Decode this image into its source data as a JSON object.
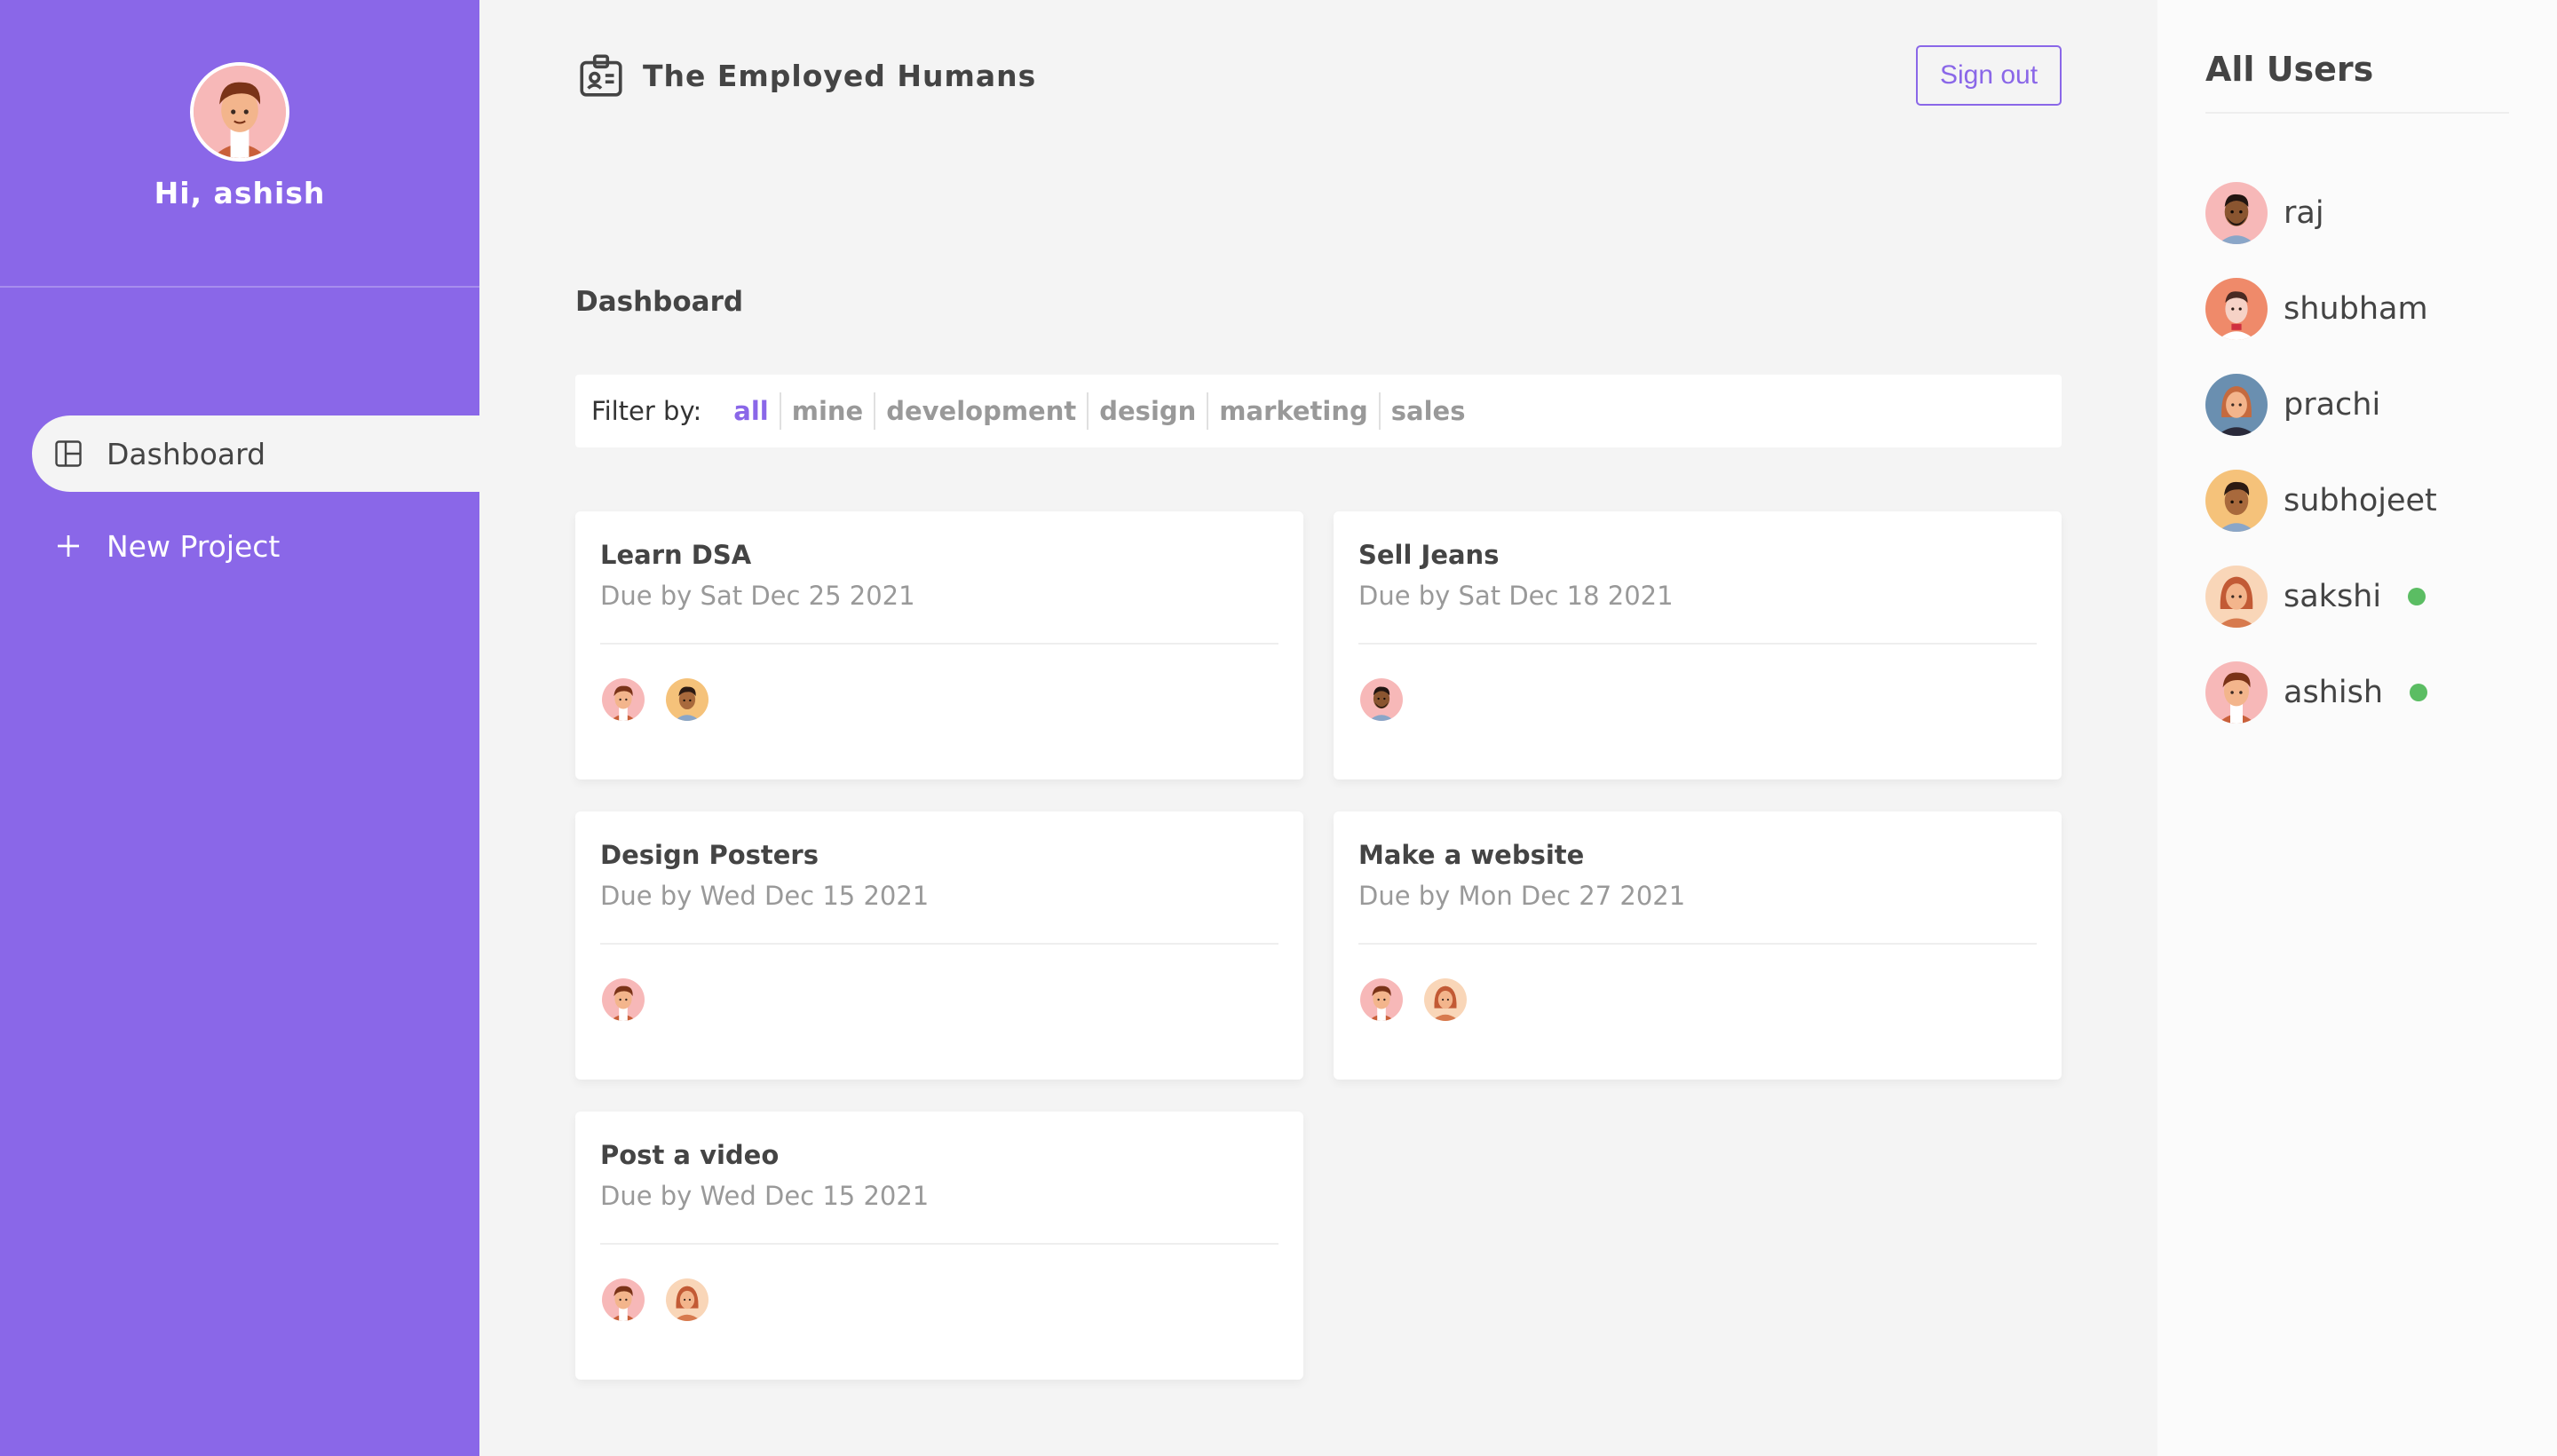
{
  "sidebar": {
    "greeting": "Hi, ashish",
    "nav": [
      {
        "label": "Dashboard",
        "icon": "dashboard-icon",
        "active": true
      },
      {
        "label": "New Project",
        "icon": "plus-icon",
        "active": false
      }
    ]
  },
  "header": {
    "app_name": "The Employed Humans",
    "sign_out_label": "Sign out"
  },
  "main": {
    "title": "Dashboard",
    "filter": {
      "label": "Filter by:",
      "options": [
        "all",
        "mine",
        "development",
        "design",
        "marketing",
        "sales"
      ],
      "active": "all"
    },
    "projects": [
      {
        "name": "Learn DSA",
        "due": "Due by Sat Dec 25 2021",
        "assignees": [
          "ashish",
          "subhojeet"
        ]
      },
      {
        "name": "Sell Jeans",
        "due": "Due by Sat Dec 18 2021",
        "assignees": [
          "raj"
        ]
      },
      {
        "name": "Design Posters",
        "due": "Due by Wed Dec 15 2021",
        "assignees": [
          "ashish"
        ]
      },
      {
        "name": "Make a website",
        "due": "Due by Mon Dec 27 2021",
        "assignees": [
          "ashish",
          "sakshi"
        ]
      },
      {
        "name": "Post a video",
        "due": "Due by Wed Dec 15 2021",
        "assignees": [
          "ashish",
          "sakshi"
        ]
      }
    ]
  },
  "users_panel": {
    "title": "All Users",
    "users": [
      {
        "name": "raj",
        "online": false
      },
      {
        "name": "shubham",
        "online": false
      },
      {
        "name": "prachi",
        "online": false
      },
      {
        "name": "subhojeet",
        "online": false
      },
      {
        "name": "sakshi",
        "online": true
      },
      {
        "name": "ashish",
        "online": true
      }
    ]
  },
  "colors": {
    "accent": "#8a67e8",
    "background": "#f4f4f4",
    "online": "#5bbd63"
  }
}
